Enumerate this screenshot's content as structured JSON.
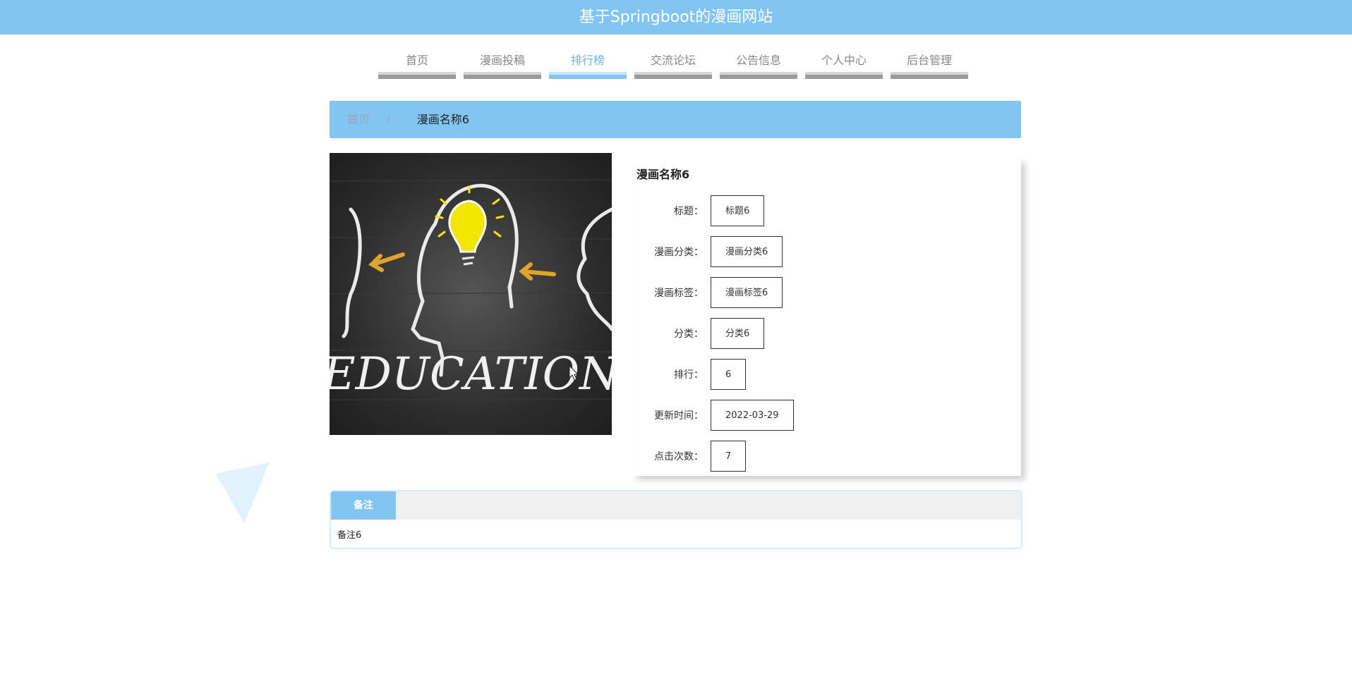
{
  "header": {
    "site_title": "基于Springboot的漫画网站"
  },
  "nav": {
    "items": [
      {
        "label": "首页"
      },
      {
        "label": "漫画投稿"
      },
      {
        "label": "排行榜"
      },
      {
        "label": "交流论坛"
      },
      {
        "label": "公告信息"
      },
      {
        "label": "个人中心"
      },
      {
        "label": "后台管理"
      }
    ],
    "active_index": 2
  },
  "breadcrumb": {
    "home": "首页",
    "separator": "/",
    "current": "漫画名称6"
  },
  "cover": {
    "text": "EDUCATION",
    "icon": "lightbulb-head-icon"
  },
  "detail": {
    "title": "漫画名称6",
    "fields": [
      {
        "label": "标题：",
        "value": "标题6"
      },
      {
        "label": "漫画分类：",
        "value": "漫画分类6"
      },
      {
        "label": "漫画标签：",
        "value": "漫画标签6"
      },
      {
        "label": "分类：",
        "value": "分类6"
      },
      {
        "label": "排行：",
        "value": "6"
      },
      {
        "label": "更新时间：",
        "value": "2022-03-29"
      },
      {
        "label": "点击次数：",
        "value": "7"
      }
    ]
  },
  "remark": {
    "tab_label": "备注",
    "content": "备注6"
  },
  "colors": {
    "accent": "#83c5f2",
    "nav_active_text": "#6fb3e8",
    "nav_bar": "#9a9a9a"
  }
}
